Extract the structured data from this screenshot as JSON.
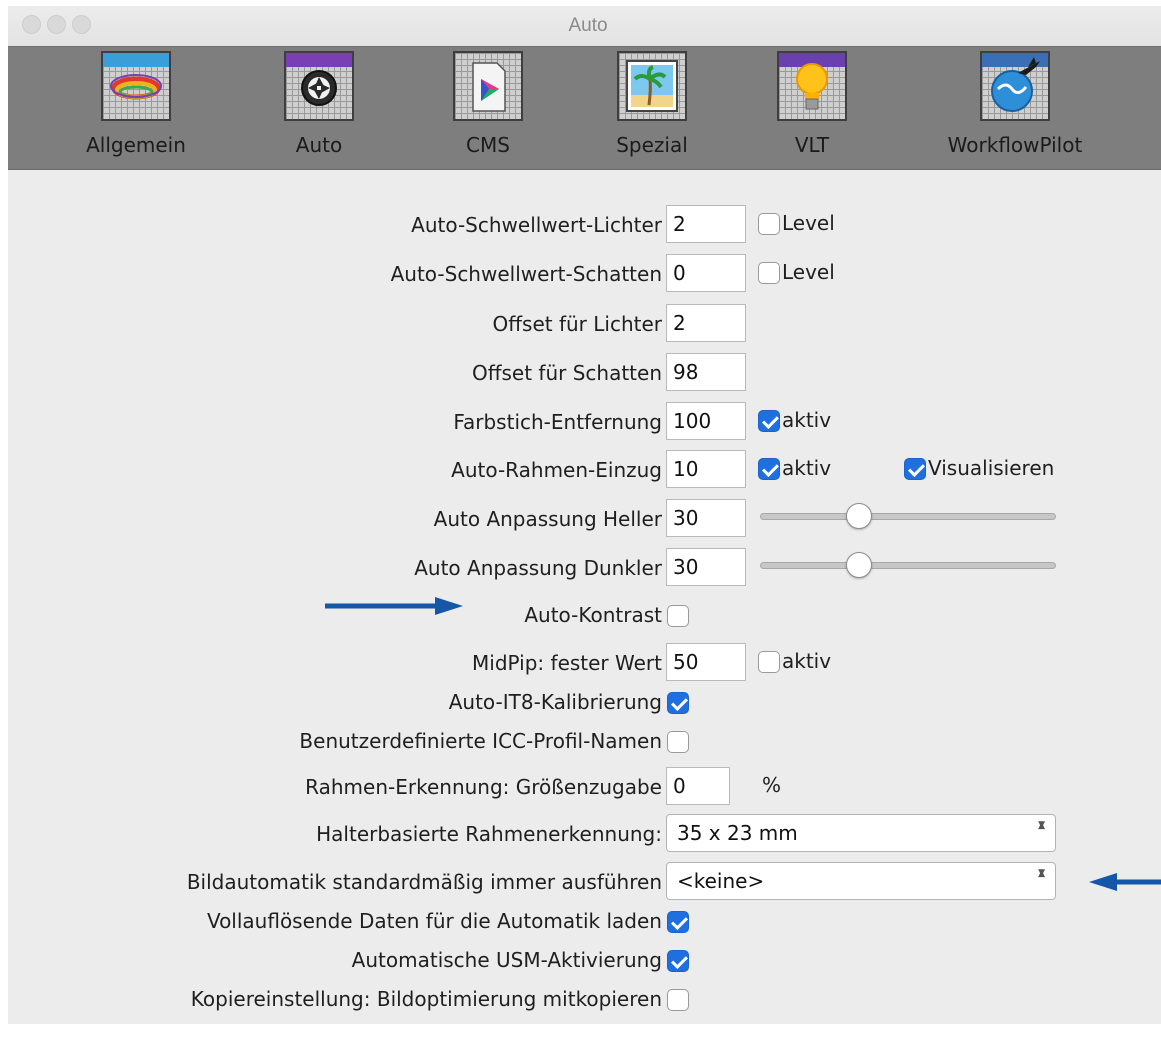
{
  "window": {
    "title": "Auto"
  },
  "toolbar": {
    "items": [
      {
        "label": "Allgemein",
        "icon": "rings-icon"
      },
      {
        "label": "Auto",
        "icon": "aperture-icon"
      },
      {
        "label": "CMS",
        "icon": "color-document-icon"
      },
      {
        "label": "Spezial",
        "icon": "palm-picture-icon"
      },
      {
        "label": "VLT",
        "icon": "lightbulb-icon"
      },
      {
        "label": "WorkflowPilot",
        "icon": "globe-plane-icon"
      }
    ],
    "active": "Auto"
  },
  "form": {
    "lichter": {
      "label": "Auto-Schwellwert-Lichter",
      "value": "2",
      "check_label": "Level",
      "checked": false
    },
    "schatten": {
      "label": "Auto-Schwellwert-Schatten",
      "value": "0",
      "check_label": "Level",
      "checked": false
    },
    "offset_lichter": {
      "label": "Offset für Lichter",
      "value": "2"
    },
    "offset_schatten": {
      "label": "Offset für Schatten",
      "value": "98"
    },
    "farbstich": {
      "label": "Farbstich-Entfernung",
      "value": "100",
      "check_label": "aktiv",
      "checked": true
    },
    "rahmen_einzug": {
      "label": "Auto-Rahmen-Einzug",
      "value": "10",
      "check_label": "aktiv",
      "checked": true,
      "check2_label": "Visualisieren",
      "checked2": true
    },
    "heller": {
      "label": "Auto Anpassung Heller",
      "value": "30",
      "slider_fraction": 0.32
    },
    "dunkler": {
      "label": "Auto Anpassung Dunkler",
      "value": "30",
      "slider_fraction": 0.32
    },
    "kontrast": {
      "label": "Auto-Kontrast",
      "checked": false
    },
    "midpip": {
      "label": "MidPip: fester Wert",
      "value": "50",
      "check_label": "aktiv",
      "checked": false
    },
    "it8": {
      "label": "Auto-IT8-Kalibrierung",
      "checked": true
    },
    "icc": {
      "label": "Benutzerdefinierte ICC-Profil-Namen",
      "checked": false
    },
    "groessenzugabe": {
      "label": "Rahmen-Erkennung: Größenzugabe",
      "value": "0",
      "unit": "%"
    },
    "halter": {
      "label": "Halterbasierte Rahmenerkennung:",
      "value": "35 x 23 mm"
    },
    "bildautomatik": {
      "label": "Bildautomatik standardmäßig immer ausführen",
      "value": "<keine>"
    },
    "vollaufloesend": {
      "label": "Vollauflösende Daten für die Automatik laden",
      "checked": true
    },
    "usm": {
      "label": "Automatische USM-Aktivierung",
      "checked": true
    },
    "kopier": {
      "label": "Kopiereinstellung: Bildoptimierung mitkopieren",
      "checked": false
    }
  },
  "colors": {
    "accent": "#1f6fe0",
    "arrow": "#1457a8",
    "toolbar": "#7e7e7e"
  }
}
